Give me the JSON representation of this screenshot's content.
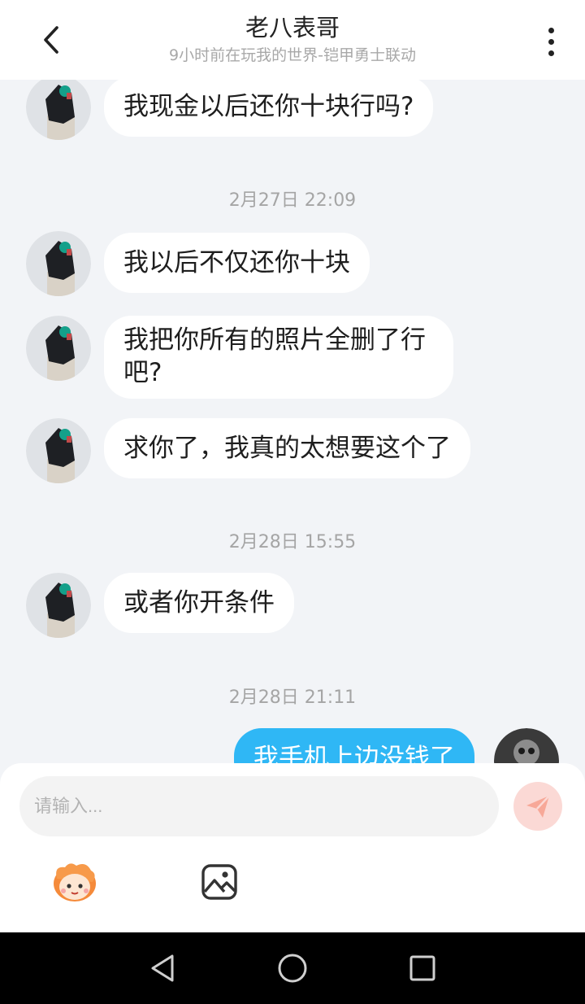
{
  "header": {
    "title": "老八表哥",
    "subtitle": "9小时前在玩我的世界-铠甲勇士联动",
    "back_icon": "chevron-left-icon",
    "more_icon": "more-vertical-icon"
  },
  "messages": [
    {
      "from": "other",
      "text": "我现金以后还你十块行吗?"
    },
    {
      "timestamp": "2月27日 22:09"
    },
    {
      "from": "other",
      "text": "我以后不仅还你十块"
    },
    {
      "from": "other",
      "text": "我把你所有的照片全删了行吧?"
    },
    {
      "from": "other",
      "text": "求你了，我真的太想要这个了"
    },
    {
      "timestamp": "2月28日 15:55"
    },
    {
      "from": "other",
      "text": "或者你开条件"
    },
    {
      "timestamp": "2月28日 21:11"
    },
    {
      "from": "me",
      "text": "我手机上边没钱了"
    }
  ],
  "bubble_lines": {
    "m4_line1": "我把你所有的照片全删了行",
    "m4_line2": "吧?"
  },
  "input": {
    "placeholder": "请输入...",
    "value": ""
  },
  "toolbar": {
    "send_icon": "paper-plane-icon",
    "emoji_icon": "mascot-emoji-icon",
    "image_icon": "image-icon"
  },
  "colors": {
    "my_bubble": "#2fb7f5",
    "other_bubble": "#ffffff",
    "chat_bg": "#f2f4f7",
    "send_button": "#fbd9d5",
    "send_icon": "#f7a898"
  },
  "navbar": {
    "back_icon": "triangle-back-icon",
    "home_icon": "circle-home-icon",
    "recents_icon": "square-recents-icon"
  }
}
